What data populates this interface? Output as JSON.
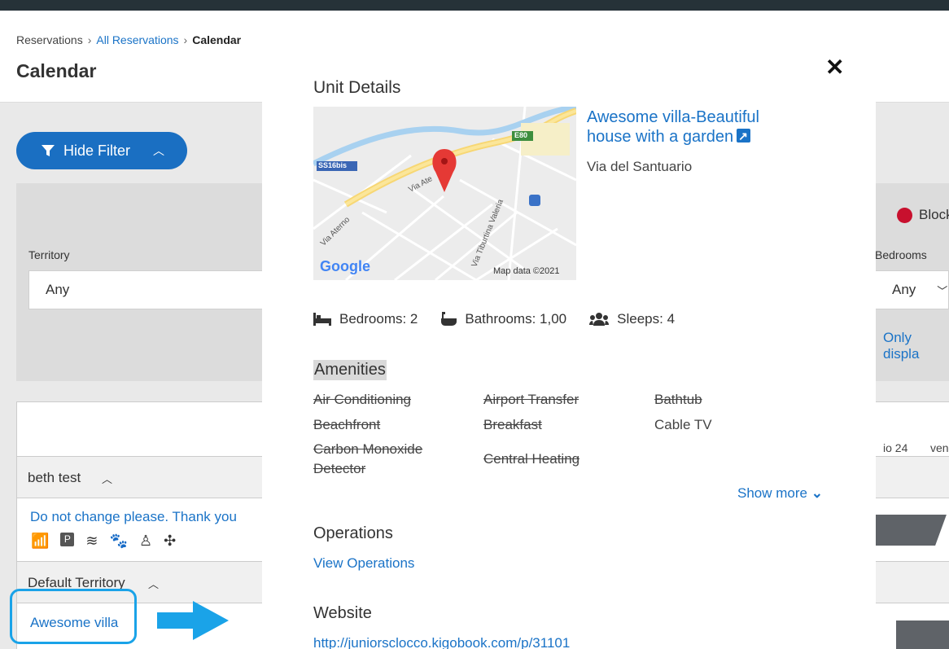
{
  "breadcrumb": {
    "item1": "Reservations",
    "item2": "All Reservations",
    "item3": "Calendar"
  },
  "page_title": "Calendar",
  "filter": {
    "toggle_label": "Hide Filter",
    "territory_label": "Territory",
    "territory_value": "Any",
    "bedrooms_label": "Bedrooms",
    "bedrooms_value": "Any",
    "legend_blocked": "Block",
    "only_display": "Only displa"
  },
  "calendar": {
    "day1": "io 24",
    "day2": "ven",
    "group1": "beth test",
    "unit1": "Do not change please. Thank you",
    "group2": "Default Territory",
    "unit2": "Awesome villa"
  },
  "modal": {
    "title": "Unit Details",
    "unit_name": "Awesome villa-Beautiful house with a garden",
    "address": "Via del Santuario",
    "map": {
      "road1": "SS16bis",
      "road2": "E80",
      "street1": "Via Ate",
      "street2": "Via Aterno",
      "street3": "Via Tiburtina Valeria",
      "attribution": "Map data ©2021",
      "logo": "Google"
    },
    "stats": {
      "bedrooms": "Bedrooms: 2",
      "bathrooms": "Bathrooms: 1,00",
      "sleeps": "Sleeps: 4"
    },
    "amenities_title": "Amenities",
    "amenities": {
      "a1": "Air Conditioning",
      "a2": "Airport Transfer",
      "a3": "Bathtub",
      "a4": "Beachfront",
      "a5": "Breakfast",
      "a6": "Cable TV",
      "a7": "Carbon Monoxide Detector",
      "a8": "Central Heating"
    },
    "show_more": "Show more",
    "operations_title": "Operations",
    "operations_link": "View Operations",
    "website_title": "Website",
    "website_link": "http://juniorsclocco.kigobook.com/p/31101"
  },
  "colors": {
    "accent": "#1a73c7",
    "filter_button": "#1a6fc2",
    "highlight": "#1aa3e8",
    "pin": "#e53935"
  }
}
